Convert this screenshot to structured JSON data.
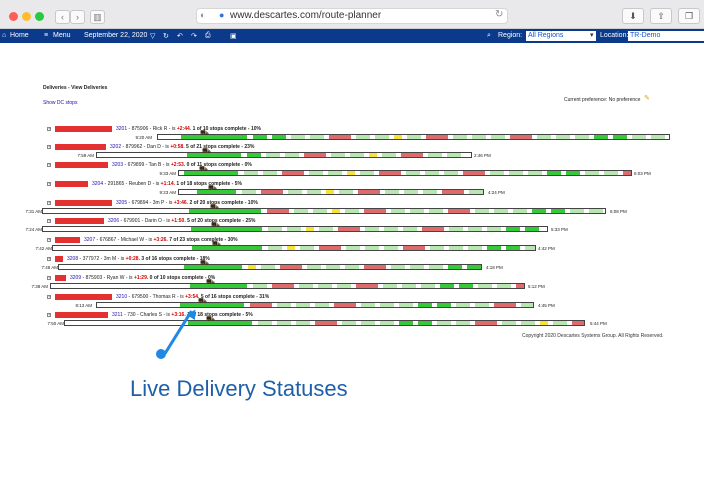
{
  "browser": {
    "url": "www.descartes.com/route-planner"
  },
  "appbar": {
    "home": "Home",
    "menu": "Menu",
    "date": "September 22, 2020",
    "region_label": "Region:",
    "region_value": "All Regions",
    "location_label": "Location:",
    "location_value": "TR-Demo"
  },
  "page": {
    "title": "Deliveries - View Deliveries",
    "show_dc_stops": "Show DC stops",
    "preference": "Current preference:  No preference",
    "copyright": "Copyright 2020 Descartes Systems Group. All Rights Reserved."
  },
  "caption": "Live Delivery Statuses",
  "routes": [
    {
      "id": "3201",
      "driver": " - 875906 - Rick R",
      "late": "+2:44.",
      "status": " 1 of 10 stops complete - 10%",
      "start": "9:20 AM",
      "end": "",
      "progress": 10
    },
    {
      "id": "3202",
      "driver": " - 879962 - Dan D",
      "late": "+0:58.",
      "status": " 5 of 21 stops complete - 23%",
      "start": "7:59 AM",
      "end": "2:46 PM",
      "progress": 23
    },
    {
      "id": "3203",
      "driver": " - 679899 - Tan B",
      "late": "+2:53.",
      "status": " 0 of 11 stops complete - 0%",
      "start": "9:33 AM",
      "end": "6:03 PM",
      "progress": 0
    },
    {
      "id": "3204",
      "driver": " - 291865 - Reuben D",
      "late": "+1:14.",
      "status": " 1 of 18 stops complete - 5%",
      "start": "9:23 AM",
      "end": "4:24 PM",
      "progress": 5
    },
    {
      "id": "3205",
      "driver": " - 679894 - 3m P",
      "late": "+3:46.",
      "status": " 2 of 20 stops complete - 10%",
      "start": "7:31 AM",
      "end": "6:08 PM",
      "progress": 10
    },
    {
      "id": "3206",
      "driver": " - 679901 - Darin O",
      "late": "+1:50.",
      "status": " 5 of 20 stops complete - 25%",
      "start": "7:24 AM",
      "end": "5:33 PM",
      "progress": 25
    },
    {
      "id": "3207",
      "driver": " - 676867 - Michael W",
      "late": "+3:26.",
      "status": " 7 of 23 stops complete - 30%",
      "start": "7:42 AM",
      "end": "4:42 PM",
      "progress": 30
    },
    {
      "id": "3208",
      "driver": " - 377972 - 3m M",
      "late": "+0:28.",
      "status": " 3 of 16 stops complete - 18%",
      "start": "7:48 AM",
      "end": "4:18 PM",
      "progress": 18
    },
    {
      "id": "3209",
      "driver": " - 875903 - Ryan W",
      "late": "+1:29.",
      "status": " 0 of 10 stops complete - 0%",
      "start": "7:38 AM",
      "end": "5:12 PM",
      "progress": 0
    },
    {
      "id": "3210",
      "driver": " - 679500 - Thomas R",
      "late": "+3:54.",
      "status": " 5 of 16 stops complete - 31%",
      "start": "8:13 AM",
      "end": "4:45 PM",
      "progress": 31
    },
    {
      "id": "3211",
      "driver": " - 730 - Charles S",
      "late": "+3:16.",
      "status": " 1 of 18 stops complete - 5%",
      "start": "7:50 AM",
      "end": "5:44 PM",
      "progress": 5
    }
  ],
  "colors": {
    "appbar": "#0b3a8b",
    "late_bar": "#e53030",
    "done": "#35c93a",
    "planned": "#b8e6b0",
    "late_segment": "#de6b6b",
    "caution": "#f5e23a",
    "callout": "#1e88e5"
  },
  "icons": [
    "home-icon",
    "menu-icon",
    "calendar-icon",
    "filter-icon",
    "refresh-icon",
    "undo-icon",
    "redo-icon",
    "print-icon",
    "search-icon",
    "truck-icon",
    "pencil-icon"
  ]
}
